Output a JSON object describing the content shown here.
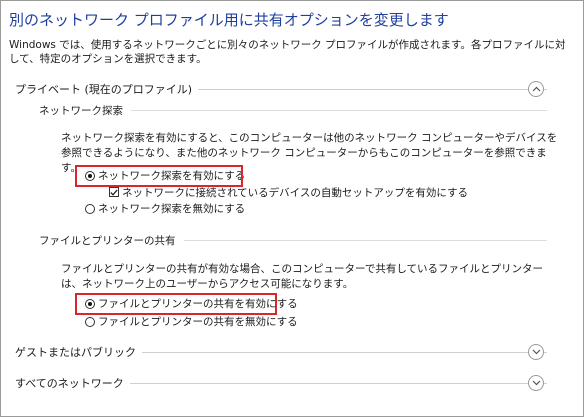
{
  "title": "別のネットワーク プロファイル用に共有オプションを変更します",
  "description": "Windows では、使用するネットワークごとに別々のネットワーク プロファイルが作成されます。各プロファイルに対して、特定のオプションを選択できます。",
  "private": {
    "label": "プライベート (現在のプロファイル)",
    "expanded": true,
    "network_discovery": {
      "label": "ネットワーク探索",
      "description": "ネットワーク探索を有効にすると、このコンピューターは他のネットワーク コンピューターやデバイスを参照できるようになり、また他のネットワーク コンピューターからもこのコンピューターを参照できます。",
      "option_on": "ネットワーク探索を有効にする",
      "auto_setup": "ネットワークに接続されているデバイスの自動セットアップを有効にする",
      "option_off": "ネットワーク探索を無効にする",
      "selected": "on",
      "auto_setup_checked": true
    },
    "file_printer_sharing": {
      "label": "ファイルとプリンターの共有",
      "description": "ファイルとプリンターの共有が有効な場合、このコンピューターで共有しているファイルとプリンターは、ネットワーク上のユーザーからアクセス可能になります。",
      "option_on": "ファイルとプリンターの共有を有効にする",
      "option_off": "ファイルとプリンターの共有を無効にする",
      "selected": "on"
    }
  },
  "guest_public": {
    "label": "ゲストまたはパブリック",
    "expanded": false
  },
  "all_networks": {
    "label": "すべてのネットワーク",
    "expanded": false
  },
  "colors": {
    "title": "#1f3f9f",
    "highlight": "#d9262b"
  },
  "icons": {
    "collapse": "chevron-up-icon",
    "expand": "chevron-down-icon"
  }
}
